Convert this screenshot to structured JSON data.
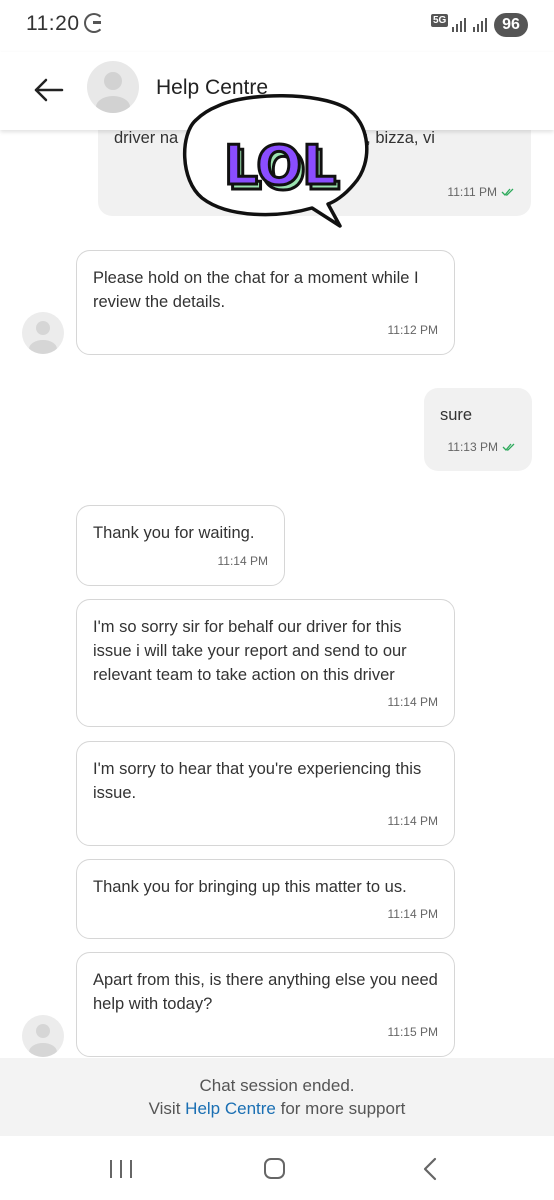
{
  "status_bar": {
    "time": "11:20",
    "network": "5G",
    "battery": "96"
  },
  "header": {
    "title": "Help Centre"
  },
  "sticker": {
    "text": "LOL"
  },
  "messages": [
    {
      "direction": "out",
      "text": "driver na                    h car number, bizza, vi",
      "time": "11:11 PM",
      "read": true
    },
    {
      "direction": "in",
      "text": "Please hold on the chat for a moment while I review the details.",
      "time": "11:12 PM"
    },
    {
      "direction": "out",
      "text": "sure",
      "time": "11:13 PM",
      "read": true
    },
    {
      "direction": "in",
      "text": "Thank you for waiting.",
      "time": "11:14 PM"
    },
    {
      "direction": "in",
      "text": "I'm so sorry sir for behalf our driver for this issue i will take your report and send to our relevant team to take action on this driver",
      "time": "11:14 PM"
    },
    {
      "direction": "in",
      "text": "I'm sorry to hear that you're experiencing this issue.",
      "time": "11:14 PM"
    },
    {
      "direction": "in",
      "text": "Thank you for bringing up this matter to us.",
      "time": "11:14 PM"
    },
    {
      "direction": "in",
      "text": "Apart from this, is there anything else you need help with today?",
      "time": "11:15 PM"
    }
  ],
  "footer": {
    "ended": "Chat session ended.",
    "visit_prefix": "Visit",
    "link": "Help Centre",
    "suffix": "for more support"
  },
  "colors": {
    "link": "#1a6fb3",
    "read_check": "#2eaa5c",
    "sticker_purple": "#8a4dff",
    "sticker_green": "#9be3b0"
  }
}
